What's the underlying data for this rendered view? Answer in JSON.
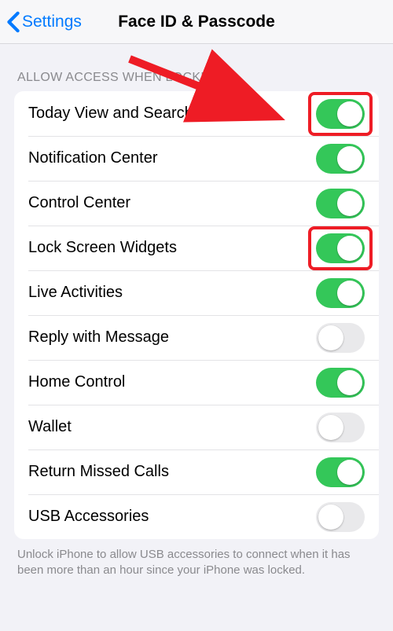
{
  "nav": {
    "back_label": "Settings",
    "title": "Face ID & Passcode"
  },
  "section_header": "ALLOW ACCESS WHEN LOCKED:",
  "rows": [
    {
      "label": "Today View and Search",
      "on": true,
      "highlight": true
    },
    {
      "label": "Notification Center",
      "on": true,
      "highlight": false
    },
    {
      "label": "Control Center",
      "on": true,
      "highlight": false
    },
    {
      "label": "Lock Screen Widgets",
      "on": true,
      "highlight": true
    },
    {
      "label": "Live Activities",
      "on": true,
      "highlight": false
    },
    {
      "label": "Reply with Message",
      "on": false,
      "highlight": false
    },
    {
      "label": "Home Control",
      "on": true,
      "highlight": false
    },
    {
      "label": "Wallet",
      "on": false,
      "highlight": false
    },
    {
      "label": "Return Missed Calls",
      "on": true,
      "highlight": false
    },
    {
      "label": "USB Accessories",
      "on": false,
      "highlight": false
    }
  ],
  "footer": "Unlock iPhone to allow USB accessories to connect when it has been more than an hour since your iPhone was locked.",
  "colors": {
    "tint": "#007aff",
    "toggle_on": "#34c759",
    "toggle_off": "#e9e9eb",
    "annotation": "#ee1c25"
  }
}
